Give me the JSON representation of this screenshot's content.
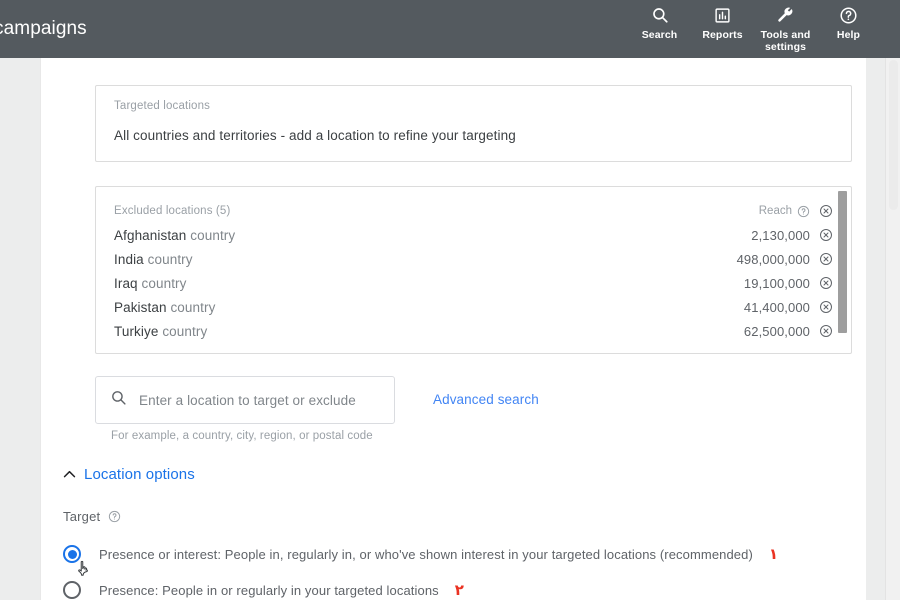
{
  "topbar": {
    "title": "campaigns",
    "items": [
      {
        "icon": "search-icon",
        "label": "Search"
      },
      {
        "icon": "reports-icon",
        "label": "Reports"
      },
      {
        "icon": "wrench-icon",
        "label": "Tools and settings"
      },
      {
        "icon": "help-icon",
        "label": "Help"
      }
    ]
  },
  "targeted": {
    "caption": "Targeted locations",
    "body": "All countries and territories - add a location to refine your targeting"
  },
  "excluded": {
    "caption": "Excluded locations (5)",
    "reach_label": "Reach",
    "reach_help_icon": "help-circle-icon",
    "remove_icon": "remove-circle-icon",
    "rows": [
      {
        "name": "Afghanistan",
        "kind": "country",
        "reach": "2,130,000"
      },
      {
        "name": "India",
        "kind": "country",
        "reach": "498,000,000"
      },
      {
        "name": "Iraq",
        "kind": "country",
        "reach": "19,100,000"
      },
      {
        "name": "Pakistan",
        "kind": "country",
        "reach": "41,400,000"
      },
      {
        "name": "Turkiye",
        "kind": "country",
        "reach": "62,500,000"
      }
    ]
  },
  "search": {
    "icon": "search-icon",
    "placeholder": "Enter a location to target or exclude",
    "value": "",
    "hint": "For example, a country, city, region, or postal code",
    "advanced_link": "Advanced search"
  },
  "location_options": {
    "caret_icon": "chevron-up-icon",
    "label": "Location options"
  },
  "target": {
    "label": "Target",
    "help_icon": "help-circle-icon",
    "options": [
      {
        "label": "Presence or interest: People in, regularly in, or who've shown interest in your targeted locations (recommended)",
        "selected": true,
        "marker": "۱"
      },
      {
        "label": "Presence: People in or regularly in your targeted locations",
        "selected": false,
        "marker": "۲"
      }
    ]
  },
  "colors": {
    "header_bg": "#545a5f",
    "accent_blue": "#1a73e8",
    "link_blue": "#4285f4",
    "marker_red": "#ea3323",
    "text_primary": "#3c4043",
    "text_secondary": "#5f6368",
    "text_muted": "#9aa0a6",
    "page_bg": "#eceded"
  }
}
